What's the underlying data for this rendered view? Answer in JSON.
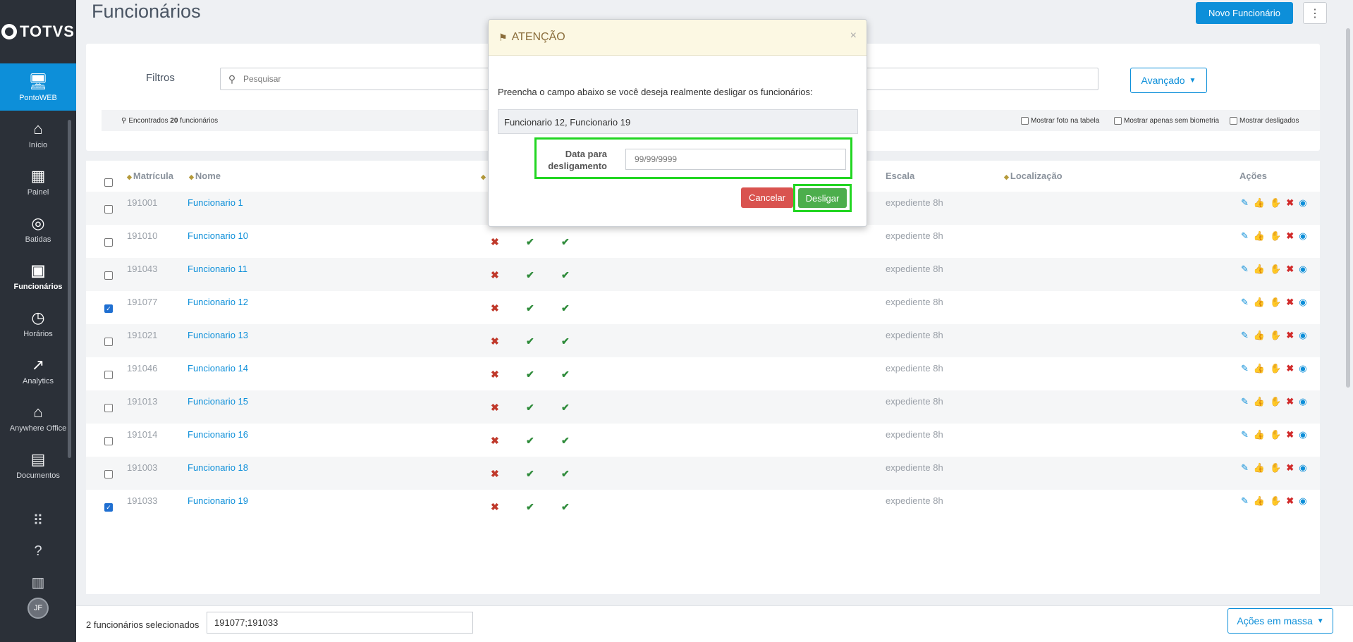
{
  "app": {
    "brand": "TOTVS"
  },
  "sidebar": {
    "items": [
      {
        "label": "PontoWEB",
        "icon": "monitor-icon"
      },
      {
        "label": "Início",
        "icon": "home-icon"
      },
      {
        "label": "Painel",
        "icon": "dashboard-icon"
      },
      {
        "label": "Batidas",
        "icon": "fingerprint-icon"
      },
      {
        "label": "Funcionários",
        "icon": "badge-icon"
      },
      {
        "label": "Horários",
        "icon": "clock-icon"
      },
      {
        "label": "Analytics",
        "icon": "trend-icon"
      },
      {
        "label": "Anywhere Office",
        "icon": "home-office-icon"
      },
      {
        "label": "Documentos",
        "icon": "document-icon"
      }
    ],
    "avatar": "JF"
  },
  "header": {
    "title": "Funcionários",
    "new_button": "Novo Funcionário",
    "more": "⋮"
  },
  "filters": {
    "label": "Filtros",
    "search_placeholder": "Pesquisar",
    "advanced": "Avançado",
    "found_prefix": "Encontrados",
    "found_count": "20",
    "found_suffix": "funcionários",
    "options": [
      "Mostrar foto na tabela",
      "Mostrar apenas sem biometria",
      "Mostrar desligados"
    ]
  },
  "table": {
    "columns": {
      "matricula": "Matrícula",
      "nome": "Nome",
      "escala": "Escala",
      "localizacao": "Localização",
      "acoes": "Ações"
    },
    "rows": [
      {
        "matricula": "191001",
        "nome": "Funcionario 1",
        "escala": "expediente 8h",
        "checked": false
      },
      {
        "matricula": "191010",
        "nome": "Funcionario 10",
        "escala": "expediente 8h",
        "checked": false
      },
      {
        "matricula": "191043",
        "nome": "Funcionario 11",
        "escala": "expediente 8h",
        "checked": false
      },
      {
        "matricula": "191077",
        "nome": "Funcionario 12",
        "escala": "expediente 8h",
        "checked": true
      },
      {
        "matricula": "191021",
        "nome": "Funcionario 13",
        "escala": "expediente 8h",
        "checked": false
      },
      {
        "matricula": "191046",
        "nome": "Funcionario 14",
        "escala": "expediente 8h",
        "checked": false
      },
      {
        "matricula": "191013",
        "nome": "Funcionario 15",
        "escala": "expediente 8h",
        "checked": false
      },
      {
        "matricula": "191014",
        "nome": "Funcionario 16",
        "escala": "expediente 8h",
        "checked": false
      },
      {
        "matricula": "191003",
        "nome": "Funcionario 18",
        "escala": "expediente 8h",
        "checked": false
      },
      {
        "matricula": "191033",
        "nome": "Funcionario 19",
        "escala": "expediente 8h",
        "checked": true
      }
    ]
  },
  "bottom": {
    "selected_label": "2 funcionários selecionados",
    "selected_value": "191077;191033",
    "mass_actions": "Ações em massa"
  },
  "modal": {
    "title": "ATENÇÃO",
    "close": "×",
    "message": "Preencha o campo abaixo se você deseja realmente desligar os funcionários:",
    "names": "Funcionario 12, Funcionario 19",
    "date_label": "Data para desligamento",
    "date_placeholder": "99/99/9999",
    "cancel": "Cancelar",
    "confirm": "Desligar"
  },
  "colors": {
    "primary": "#0d8fd9",
    "danger": "#d9534f",
    "success": "#4cae4c",
    "highlight": "#22d622",
    "warning_bg": "#fcf8e3"
  }
}
